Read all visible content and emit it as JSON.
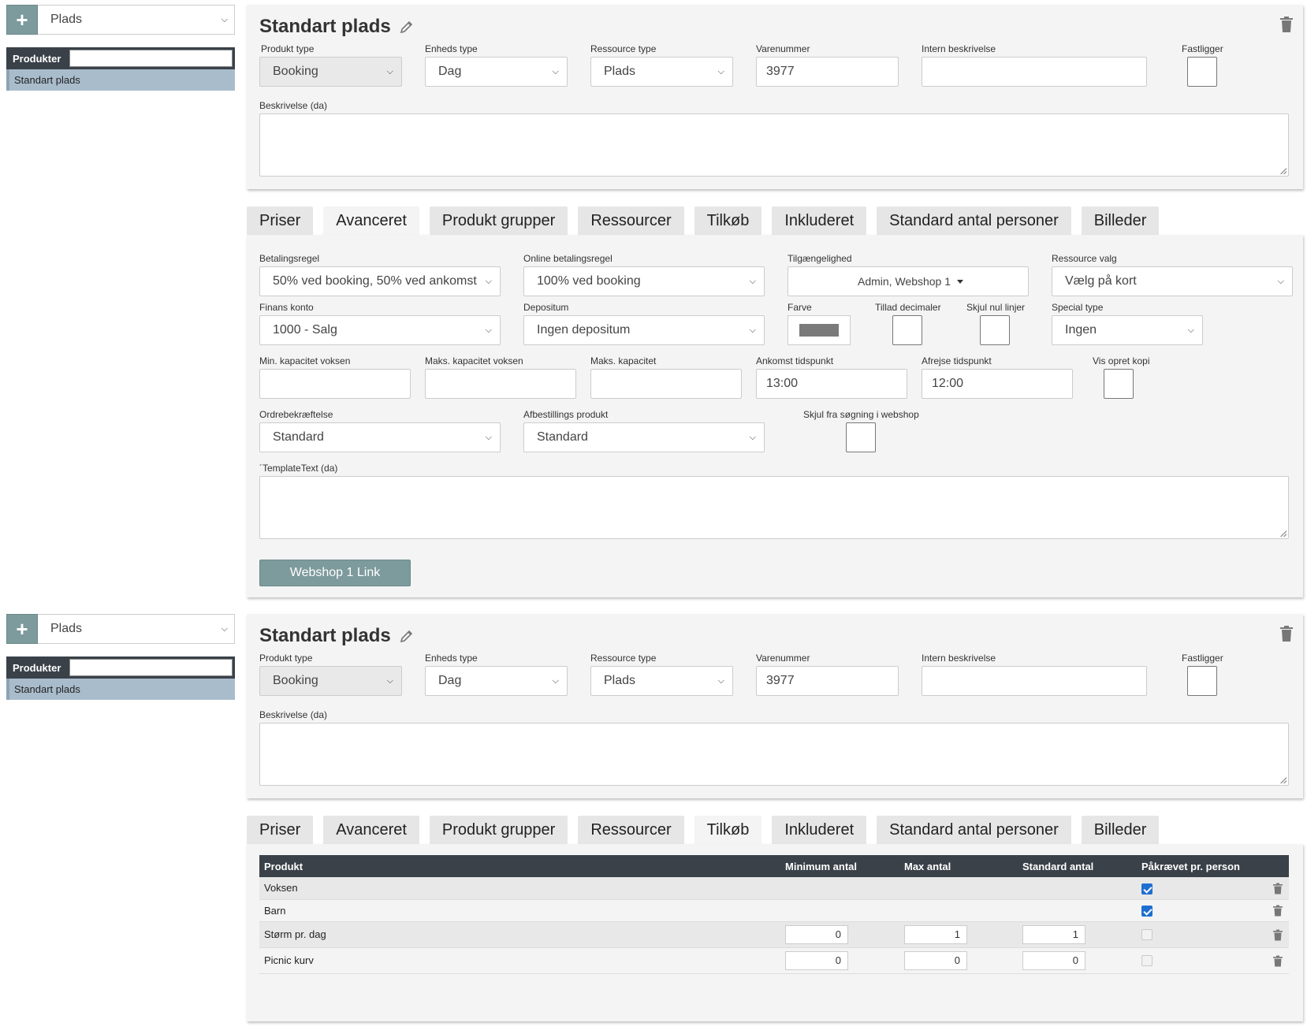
{
  "sidebar": {
    "category_value": "Plads",
    "products_header": "Produkter",
    "items": [
      {
        "label": "Standart plads"
      }
    ]
  },
  "product": {
    "title": "Standart plads",
    "labels": {
      "product_type": "Produkt type",
      "unit_type": "Enheds type",
      "resource_type": "Ressource type",
      "item_number": "Varenummer",
      "internal_description": "Intern beskrivelse",
      "fixed": "Fastligger",
      "description": "Beskrivelse (da)"
    },
    "values": {
      "product_type": "Booking",
      "unit_type": "Dag",
      "resource_type": "Plads",
      "item_number": "3977"
    }
  },
  "tabs": [
    "Priser",
    "Avanceret",
    "Produkt grupper",
    "Ressourcer",
    "Tilkøb",
    "Inkluderet",
    "Standard antal personer",
    "Billeder"
  ],
  "advanced": {
    "labels": {
      "payment_rule": "Betalingsregel",
      "online_payment_rule": "Online betalingsregel",
      "availability": "Tilgængelighed",
      "resource_choice": "Ressource valg",
      "finance_account": "Finans konto",
      "deposit": "Depositum",
      "color": "Farve",
      "allow_decimals": "Tillad decimaler",
      "hide_zero_lines": "Skjul nul linjer",
      "special_type": "Special type",
      "min_capacity_adult": "Min. kapacitet voksen",
      "max_capacity_adult": "Maks. kapacitet voksen",
      "max_capacity": "Maks. kapacitet",
      "arrival_time": "Ankomst tidspunkt",
      "departure_time": "Afrejse tidspunkt",
      "show_create_copy": "Vis opret kopi",
      "order_confirmation": "Ordrebekræftelse",
      "cancellation_product": "Afbestillings produkt",
      "hide_from_search": "Skjul fra søgning i webshop",
      "template_text": "´TemplateText (da)"
    },
    "values": {
      "payment_rule": "50% ved booking, 50% ved ankomst",
      "online_payment_rule": "100% ved booking",
      "availability": "Admin, Webshop 1",
      "resource_choice": "Vælg på kort",
      "finance_account": "1000 - Salg",
      "deposit": "Ingen depositum",
      "color": "#7a7a7a",
      "special_type": "Ingen",
      "arrival_time": "13:00",
      "departure_time": "12:00",
      "order_confirmation": "Standard",
      "cancellation_product": "Standard"
    },
    "webshop_button": "Webshop 1 Link"
  },
  "addons": {
    "columns": [
      "Produkt",
      "Minimum antal",
      "Max antal",
      "Standard antal",
      "Påkrævet pr. person"
    ],
    "rows": [
      {
        "product": "Voksen",
        "min": "",
        "max": "",
        "std": "",
        "required": true
      },
      {
        "product": "Barn",
        "min": "",
        "max": "",
        "std": "",
        "required": true
      },
      {
        "product": "Størm pr. dag",
        "min": "0",
        "max": "1",
        "std": "1",
        "required": false
      },
      {
        "product": "Picnic kurv",
        "min": "0",
        "max": "0",
        "std": "0",
        "required": false
      }
    ]
  }
}
